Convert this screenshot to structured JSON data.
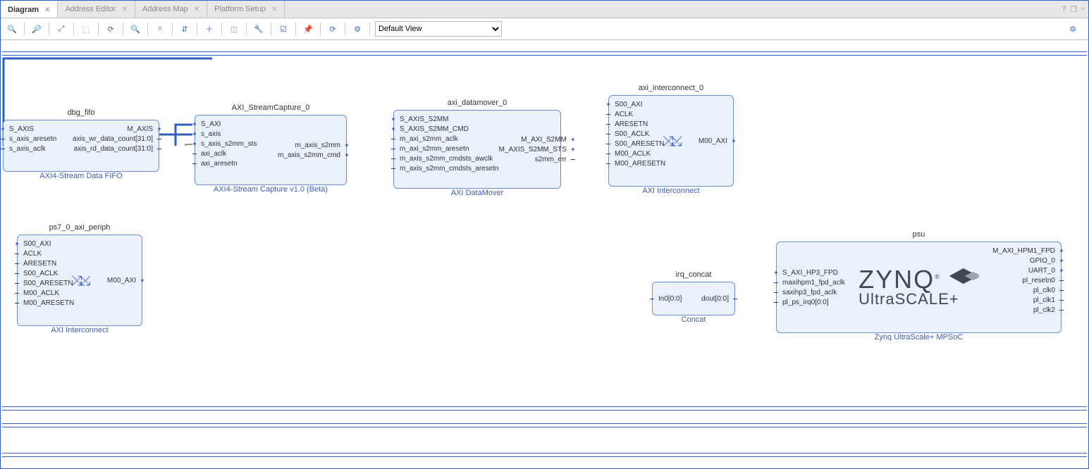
{
  "tabs": [
    {
      "label": "Diagram",
      "active": true
    },
    {
      "label": "Address Editor",
      "active": false
    },
    {
      "label": "Address Map",
      "active": false
    },
    {
      "label": "Platform Setup",
      "active": false
    }
  ],
  "toolbar": {
    "view_label": "Default View"
  },
  "blocks": {
    "dbg_fifo": {
      "title": "dbg_fifo",
      "caption": "AXI4-Stream Data FIFO",
      "left": [
        {
          "n": "S_AXIS",
          "t": "bus"
        },
        {
          "n": "s_axis_aresetn",
          "t": "sig"
        },
        {
          "n": "s_axis_aclk",
          "t": "sig"
        }
      ],
      "right": [
        {
          "n": "M_AXIS",
          "t": "bus"
        },
        {
          "n": "axis_wr_data_count[31:0]",
          "t": "sig"
        },
        {
          "n": "axis_rd_data_count[31:0]",
          "t": "sig"
        }
      ]
    },
    "streamcap": {
      "title": "AXI_StreamCapture_0",
      "caption": "AXI4-Stream Capture v1.0 (Beta)",
      "left": [
        {
          "n": "S_AXI",
          "t": "bus"
        },
        {
          "n": "s_axis",
          "t": "bus"
        },
        {
          "n": "s_axis_s2mm_sts",
          "t": "bus"
        },
        {
          "n": "axi_aclk",
          "t": "sig"
        },
        {
          "n": "axi_aresetn",
          "t": "sig"
        }
      ],
      "right": [
        {
          "n": "m_axis_s2mm",
          "t": "bus"
        },
        {
          "n": "m_axis_s2mm_cmd",
          "t": "bus"
        }
      ]
    },
    "datamover": {
      "title": "axi_datamover_0",
      "caption": "AXI DataMover",
      "left": [
        {
          "n": "S_AXIS_S2MM",
          "t": "bus"
        },
        {
          "n": "S_AXIS_S2MM_CMD",
          "t": "bus"
        },
        {
          "n": "m_axi_s2mm_aclk",
          "t": "sig"
        },
        {
          "n": "m_axi_s2mm_aresetn",
          "t": "sig"
        },
        {
          "n": "m_axis_s2mm_cmdsts_awclk",
          "t": "sig"
        },
        {
          "n": "m_axis_s2mm_cmdsts_aresetn",
          "t": "sig"
        }
      ],
      "right": [
        {
          "n": "M_AXI_S2MM",
          "t": "bus"
        },
        {
          "n": "M_AXIS_S2MM_STS",
          "t": "bus"
        },
        {
          "n": "s2mm_err",
          "t": "sig"
        }
      ]
    },
    "axi_ic0": {
      "title": "axi_interconnect_0",
      "caption": "AXI Interconnect",
      "left": [
        {
          "n": "S00_AXI",
          "t": "bus"
        },
        {
          "n": "ACLK",
          "t": "sig"
        },
        {
          "n": "ARESETN",
          "t": "sig"
        },
        {
          "n": "S00_ACLK",
          "t": "sig"
        },
        {
          "n": "S00_ARESETN",
          "t": "sig"
        },
        {
          "n": "M00_ACLK",
          "t": "sig"
        },
        {
          "n": "M00_ARESETN",
          "t": "sig"
        }
      ],
      "right": [
        {
          "n": "M00_AXI",
          "t": "bus"
        }
      ]
    },
    "ps7_periph": {
      "title": "ps7_0_axi_periph",
      "caption": "AXI Interconnect",
      "left": [
        {
          "n": "S00_AXI",
          "t": "bus"
        },
        {
          "n": "ACLK",
          "t": "sig"
        },
        {
          "n": "ARESETN",
          "t": "sig"
        },
        {
          "n": "S00_ACLK",
          "t": "sig"
        },
        {
          "n": "S00_ARESETN",
          "t": "sig"
        },
        {
          "n": "M00_ACLK",
          "t": "sig"
        },
        {
          "n": "M00_ARESETN",
          "t": "sig"
        }
      ],
      "right": [
        {
          "n": "M00_AXI",
          "t": "bus"
        }
      ]
    },
    "irq_concat": {
      "title": "irq_concat",
      "caption": "Concat",
      "left": [
        {
          "n": "In0[0:0]",
          "t": "sig"
        }
      ],
      "right": [
        {
          "n": "dout[0:0]",
          "t": "sig"
        }
      ]
    },
    "psu": {
      "title": "psu",
      "caption": "Zynq UltraScale+ MPSoC",
      "left": [
        {
          "n": "S_AXI_HP3_FPD",
          "t": "bus"
        },
        {
          "n": "maxihpm1_fpd_aclk",
          "t": "sig"
        },
        {
          "n": "saxihp3_fpd_aclk",
          "t": "sig"
        },
        {
          "n": "pl_ps_irq0[0:0]",
          "t": "sig"
        }
      ],
      "right": [
        {
          "n": "M_AXI_HPM1_FPD",
          "t": "bus"
        },
        {
          "n": "GPIO_0",
          "t": "bus"
        },
        {
          "n": "UART_0",
          "t": "bus"
        },
        {
          "n": "pl_resetn0",
          "t": "sig"
        },
        {
          "n": "pl_clk0",
          "t": "sig"
        },
        {
          "n": "pl_clk1",
          "t": "sig"
        },
        {
          "n": "pl_clk2",
          "t": "sig"
        }
      ]
    }
  },
  "zynq_logo": {
    "l1": "ZYNQ",
    "l2a": "Ultra",
    "l2b": "SCALE+"
  }
}
